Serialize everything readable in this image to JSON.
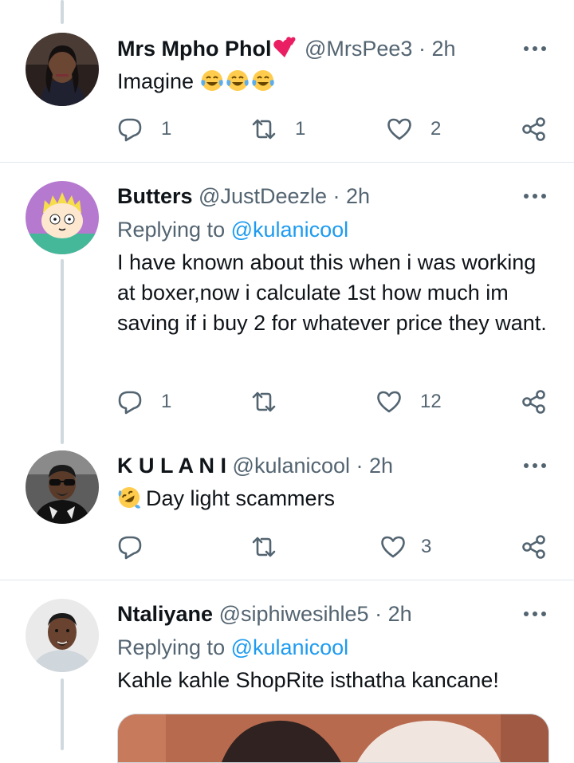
{
  "tweets": [
    {
      "name": "Mrs Mpho Phol",
      "handle": "@MrsPee3",
      "time": "· 2h",
      "text": "Imagine",
      "reply_count": "1",
      "retweet_count": "1",
      "like_count": "2"
    },
    {
      "name": "Butters",
      "handle": "@JustDeezle",
      "time": "· 2h",
      "replying_prefix": "Replying to",
      "replying_to": "@kulanicool",
      "text": "I have known about this when i was working at boxer,now i calculate 1st how much im saving if i buy 2 for whatever price they want.",
      "reply_count": "1",
      "retweet_count": "",
      "like_count": "12"
    },
    {
      "name": "K U L A N I",
      "handle": "@kulanicool",
      "time": "· 2h",
      "text": "Day light scammers",
      "reply_count": "",
      "retweet_count": "",
      "like_count": "3"
    },
    {
      "name": "Ntaliyane",
      "handle": "@siphiwesihle5",
      "time": "· 2h",
      "replying_prefix": "Replying to",
      "replying_to": "@kulanicool",
      "text": "Kahle kahle ShopRite isthatha kancane!"
    }
  ],
  "icons": {
    "reply": "comment-icon",
    "retweet": "retweet-icon",
    "like": "heart-icon",
    "share": "share-icon",
    "more": "more-dots-icon"
  },
  "colors": {
    "link": "#1d9bf0",
    "secondary_text": "#536471",
    "primary_text": "#0f1419",
    "divider": "#e1e8ed",
    "thread_line": "#cfd9de"
  }
}
